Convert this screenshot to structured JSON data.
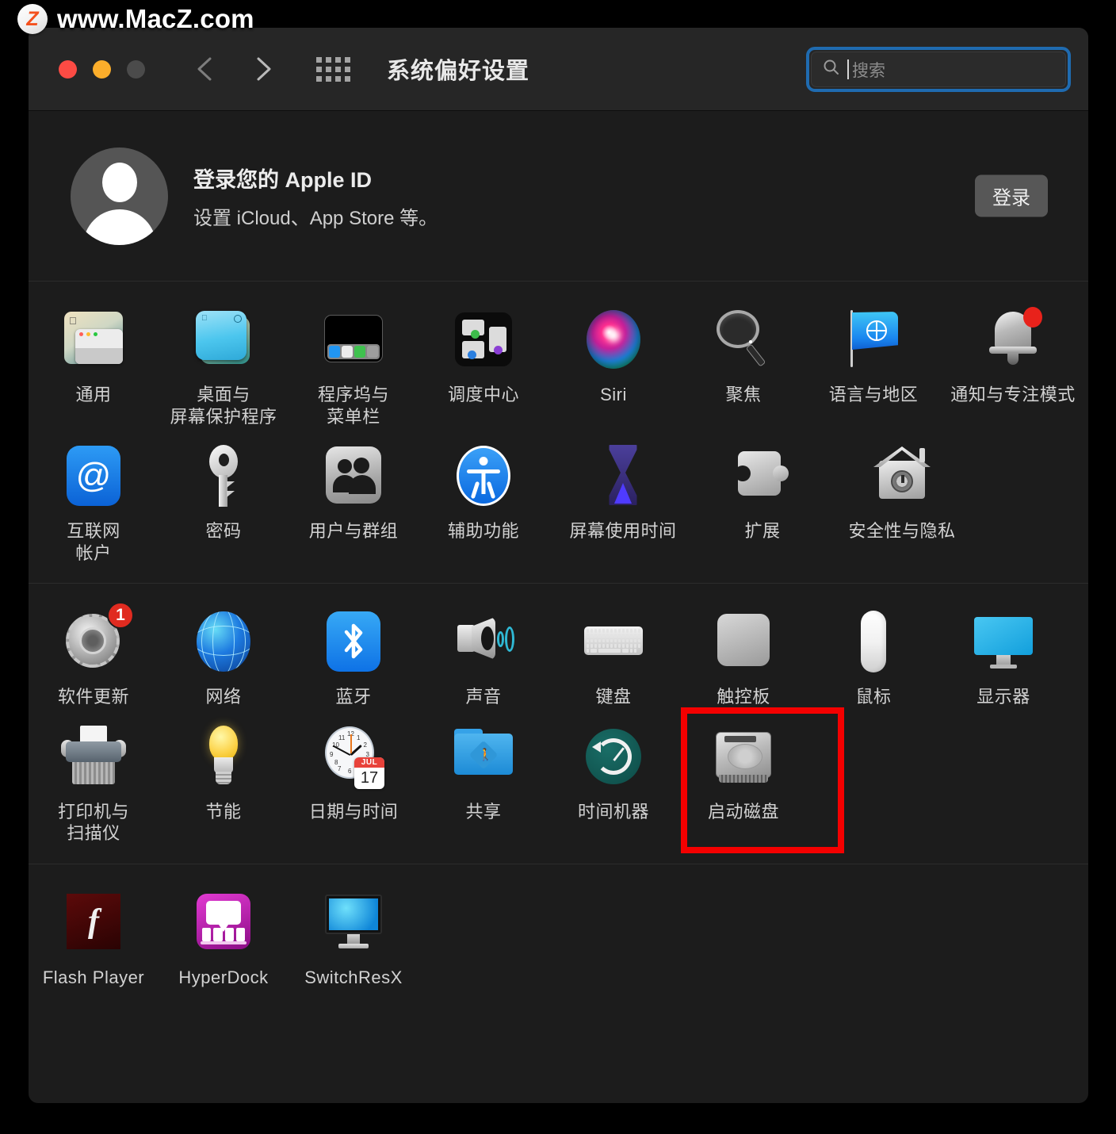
{
  "watermark": {
    "badge": "Z",
    "text": "www.MacZ.com"
  },
  "window": {
    "title": "系统偏好设置",
    "traffic": {
      "close": "close-button",
      "minimize": "minimize-button",
      "zoom": "zoom-button"
    },
    "nav": {
      "back": "back-button",
      "forward": "forward-button",
      "grid": "show-all-button"
    },
    "search": {
      "placeholder": "搜索",
      "value": ""
    }
  },
  "apple_id": {
    "title": "登录您的 Apple ID",
    "subtitle": "设置 iCloud、App Store 等。",
    "sign_in_label": "登录"
  },
  "sections": [
    {
      "name": "personal",
      "rows": [
        [
          {
            "label": "通用",
            "icon": "general-icon"
          },
          {
            "label": "桌面与\n屏幕保护程序",
            "icon": "desktop-screensaver-icon"
          },
          {
            "label": "程序坞与\n菜单栏",
            "icon": "dock-menubar-icon"
          },
          {
            "label": "调度中心",
            "icon": "mission-control-icon"
          },
          {
            "label": "Siri",
            "icon": "siri-icon"
          },
          {
            "label": "聚焦",
            "icon": "spotlight-icon"
          },
          {
            "label": "语言与地区",
            "icon": "language-region-icon"
          },
          {
            "label": "通知与专注模式",
            "icon": "notifications-focus-icon",
            "badge": ""
          }
        ],
        [
          {
            "label": "互联网\n帐户",
            "icon": "internet-accounts-icon"
          },
          {
            "label": "密码",
            "icon": "passwords-icon"
          },
          {
            "label": "用户与群组",
            "icon": "users-groups-icon"
          },
          {
            "label": "辅助功能",
            "icon": "accessibility-icon"
          },
          {
            "label": "屏幕使用时间",
            "icon": "screen-time-icon"
          },
          {
            "label": "扩展",
            "icon": "extensions-icon"
          },
          {
            "label": "安全性与隐私",
            "icon": "security-privacy-icon"
          }
        ]
      ]
    },
    {
      "name": "hardware",
      "rows": [
        [
          {
            "label": "软件更新",
            "icon": "software-update-icon",
            "badge": "1"
          },
          {
            "label": "网络",
            "icon": "network-icon"
          },
          {
            "label": "蓝牙",
            "icon": "bluetooth-icon"
          },
          {
            "label": "声音",
            "icon": "sound-icon"
          },
          {
            "label": "键盘",
            "icon": "keyboard-icon"
          },
          {
            "label": "触控板",
            "icon": "trackpad-icon"
          },
          {
            "label": "鼠标",
            "icon": "mouse-icon"
          },
          {
            "label": "显示器",
            "icon": "displays-icon"
          }
        ],
        [
          {
            "label": "打印机与\n扫描仪",
            "icon": "printers-scanners-icon"
          },
          {
            "label": "节能",
            "icon": "energy-saver-icon"
          },
          {
            "label": "日期与时间",
            "icon": "date-time-icon",
            "cal_month": "JUL",
            "cal_day": "17"
          },
          {
            "label": "共享",
            "icon": "sharing-icon"
          },
          {
            "label": "时间机器",
            "icon": "time-machine-icon"
          },
          {
            "label": "启动磁盘",
            "icon": "startup-disk-icon",
            "highlight": true
          }
        ]
      ]
    },
    {
      "name": "third-party",
      "rows": [
        [
          {
            "label": "Flash Player",
            "icon": "flash-player-icon",
            "glyph": "f"
          },
          {
            "label": "HyperDock",
            "icon": "hyperdock-icon"
          },
          {
            "label": "SwitchResX",
            "icon": "switchresx-icon"
          }
        ]
      ]
    }
  ],
  "colors": {
    "highlight_box": "#f40000",
    "search_focus_ring": "#1f6bb0",
    "badge_red": "#e02b20",
    "window_bg": "#1c1c1c",
    "titlebar_bg": "#262626"
  }
}
